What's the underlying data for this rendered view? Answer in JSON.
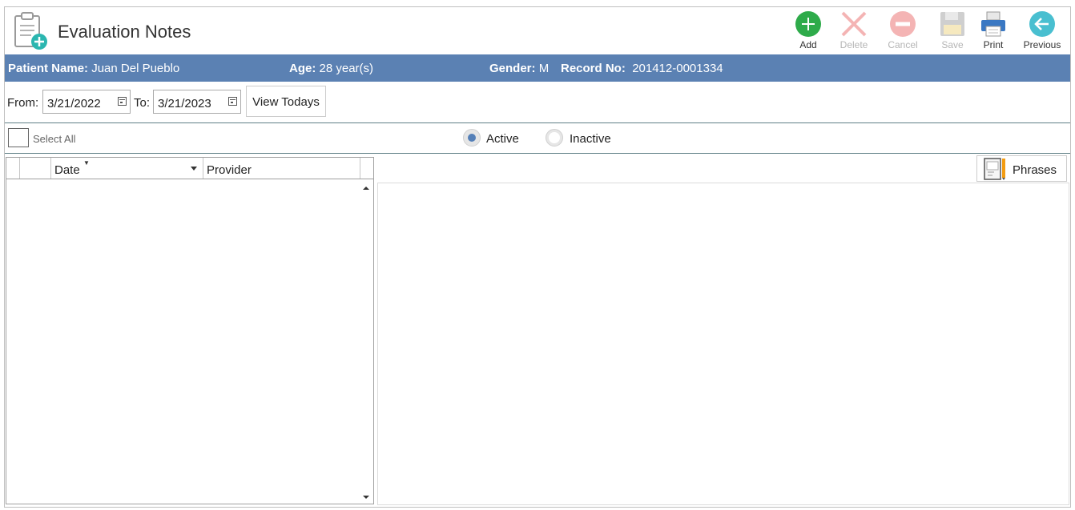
{
  "header": {
    "title": "Evaluation Notes",
    "icon": "clipboard-add-icon"
  },
  "toolbar": {
    "add": {
      "label": "Add",
      "icon": "plus-circle-icon",
      "color": "#2eab4a",
      "enabled": true
    },
    "delete": {
      "label": "Delete",
      "icon": "x-icon",
      "color": "#f4b4b4",
      "enabled": false
    },
    "cancel": {
      "label": "Cancel",
      "icon": "minus-circle-icon",
      "color": "#f4b4b4",
      "enabled": false
    },
    "save": {
      "label": "Save",
      "icon": "floppy-icon",
      "color": "#c8c8c8",
      "enabled": false
    },
    "print": {
      "label": "Print",
      "icon": "printer-icon",
      "color": "#3a78c3",
      "enabled": true
    },
    "previous": {
      "label": "Previous",
      "icon": "arrow-left-circle-icon",
      "color": "#49bfd0",
      "enabled": true
    }
  },
  "patient": {
    "name_label": "Patient Name:",
    "name": "Juan Del Pueblo",
    "age_label": "Age:",
    "age": "28 year(s)",
    "gender_label": "Gender:",
    "gender": "M",
    "record_label": "Record No:",
    "record": "201412-0001334",
    "bar_color": "#5b81b3"
  },
  "filter": {
    "from_label": "From:",
    "from_value": "3/21/2022",
    "to_label": "To:",
    "to_value": "3/21/2023",
    "view_todays": "View Todays"
  },
  "selection": {
    "select_all": "Select All",
    "status_options": [
      {
        "label": "Active",
        "selected": true
      },
      {
        "label": "Inactive",
        "selected": false
      }
    ]
  },
  "grid": {
    "columns": [
      "Date",
      "Provider"
    ],
    "rows": []
  },
  "phrases": {
    "label": "Phrases"
  }
}
